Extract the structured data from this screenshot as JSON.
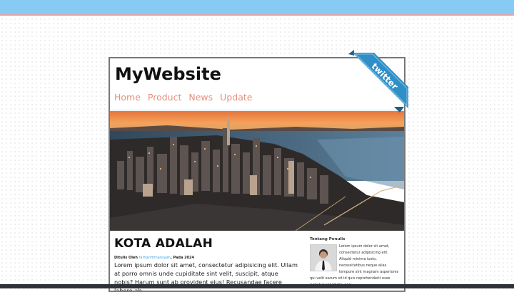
{
  "site": {
    "brand": "MyWebsite",
    "nav": [
      "Home",
      "Product",
      "News",
      "Update"
    ]
  },
  "ribbon": {
    "label": "twitter"
  },
  "article": {
    "title": "KOTA ADALAH",
    "byline_prefix": "Ditulis Oleh",
    "author": "farhanfirmansyah",
    "byline_suffix": ", Pada 2024",
    "body": "Lorem ipsum dolor sit amet, consectetur adipisicing elit. Ullam at porro omnis unde cupiditate sint velit, suscipit, atque nobis? Harum sunt ab provident eius! Recusandae facere labore ab"
  },
  "aside": {
    "title": "Tentang Penulis",
    "text": "Lorem ipsum dolor sit amet, consectetur adipisicing elit. Aliquid minima iusto, necessitatibus neque alias tempore sint magnam asperiores qui velit earum sit id quis reprehenderit esse pariatur voluptate, non"
  },
  "colors": {
    "top_bar": "#87cbf5",
    "nav_link": "#e6907c",
    "author_link": "#47a4e4",
    "ribbon": "#2f8fc7"
  }
}
